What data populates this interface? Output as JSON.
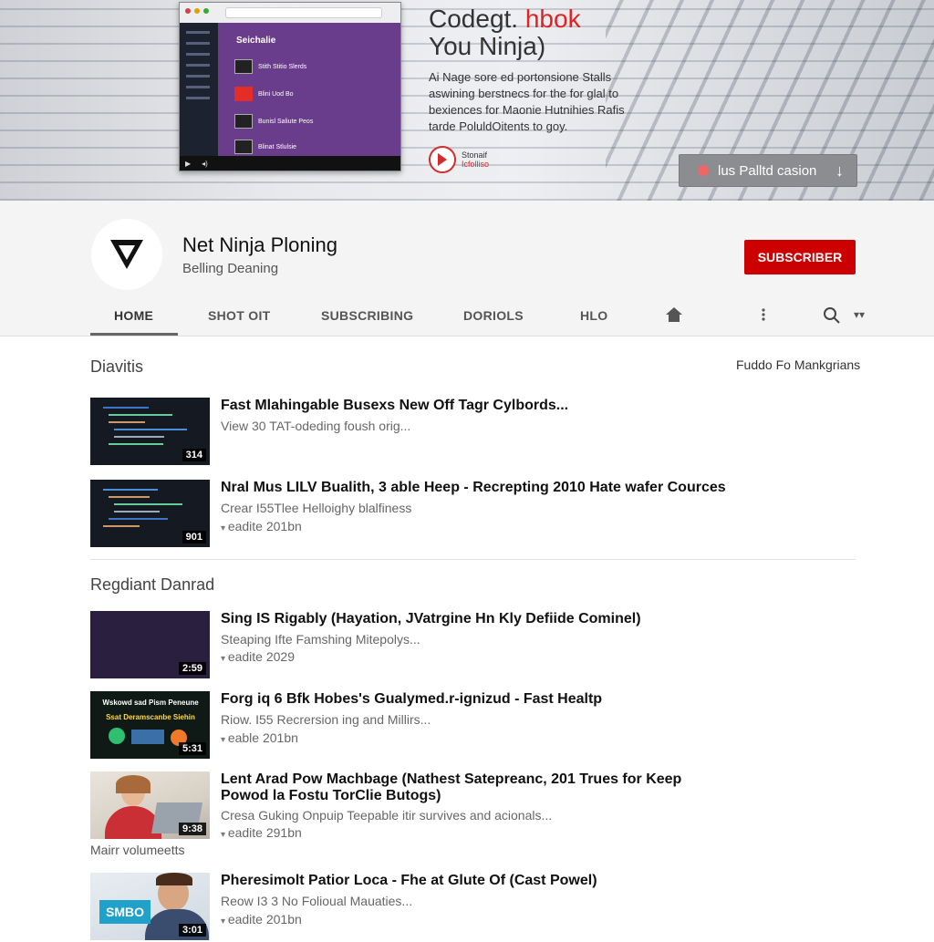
{
  "banner": {
    "title_line1_a": "Codegt.",
    "title_line1_b": "hbok",
    "title_line2": "You Ninja)",
    "description": "Ai Nage sore ed portonsione Stalls aswining berstnecs for the for glal to bexiences for Maonie Hutnihies Rafis tarde PoluldOitents to goy.",
    "logo_line1": "Stonaif",
    "logo_line2": "Icfolliso",
    "pill_label": "lus Palltd casion",
    "mock": {
      "title": "Seichalie",
      "rows": [
        "Stith Stitio Slerds",
        "Blini Uod Bo",
        "Bunisl Saliute Peos",
        "Blinat Stlulsie"
      ]
    }
  },
  "channel": {
    "name": "Net Ninja Ploning",
    "subtitle": "Belling Deaning",
    "subscribe_label": "SUBSCRIBER"
  },
  "tabs": [
    "HOME",
    "SHOT OIT",
    "SUBSCRIBING",
    "DORIOLS",
    "HLO"
  ],
  "sections": [
    {
      "title": "Diavitis",
      "sort_label": "Fuddo Fo Mankgrians",
      "videos": [
        {
          "title": "Fast Mlahingable Busexs New Off Tagr Cylbords...",
          "meta": "View 30 TAT-odeding foush orig...",
          "date": "",
          "duration": "314"
        },
        {
          "title": "Nral Mus LILV Bualith, 3 able Heep - Recrepting 2010 Hate wafer Cources",
          "meta": "Crear I55Tlee Helloighy blalfiness",
          "date": "eadite 201bn",
          "duration": "901"
        }
      ]
    },
    {
      "title": "Regdiant Danrad",
      "videos": [
        {
          "title": "Sing IS Rigably (Hayation, JVatrgine Hn Kly Defiide Cominel)",
          "meta": "Steaping Ifte Famshing Mitepolys...",
          "date": "eadite 2029",
          "duration": "2:59"
        },
        {
          "title": "Forg iq 6 Bfk Hobes's Gualymed.r-ignizud - Fast Healtp",
          "meta": "Riow. I55 Recrersion ing and Millirs...",
          "date": "eable 201bn",
          "duration": "5:31",
          "poster_line1": "Wskowd sad Pism Peneune",
          "poster_line2": "Ssat Deramscanbe Siehin"
        },
        {
          "title": "Lent Arad Pow Machbage (Nathest Satepreanc, 201 Trues for Keep Powod la Fostu TorClie Butogs)",
          "meta": "Cresa Guking Onpuip Teepable itir survives and acionals...",
          "date": "eadite 291bn",
          "duration": "9:38"
        },
        {
          "title": "Pheresimolt Patior Loca - Fhe at Glute Of (Cast Powel)",
          "meta": "Reow I3 3 No Folioual Mauaties...",
          "date": "eadite 201bn",
          "duration": "3:01",
          "thumb_text": "SMBO"
        }
      ]
    }
  ],
  "caption": "Mairr volumeetts",
  "colors": {
    "accent": "#cc0000",
    "mock_purple": "#6a3c8c"
  }
}
